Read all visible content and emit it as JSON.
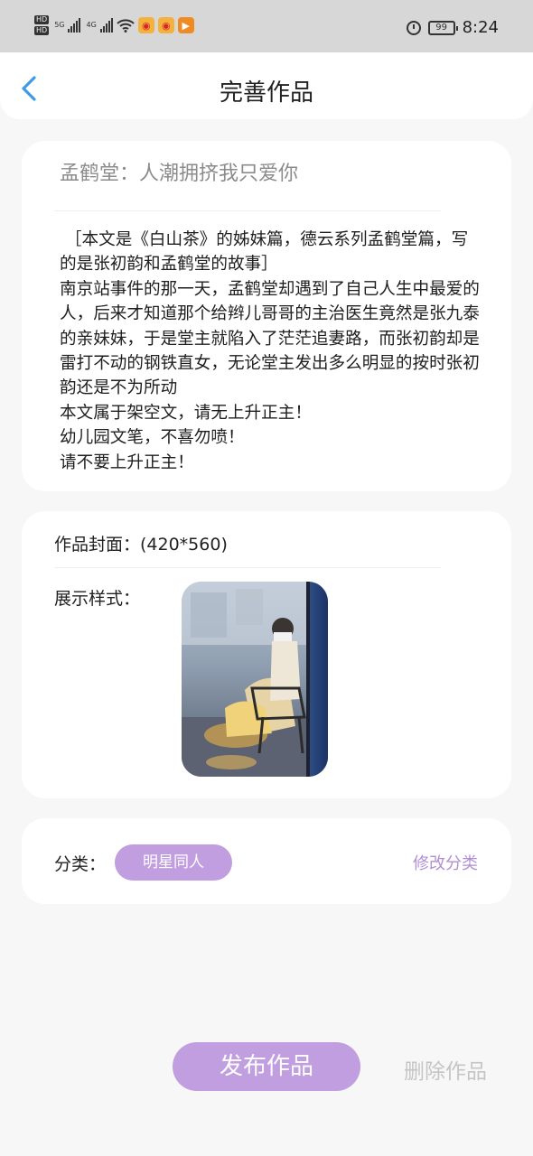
{
  "status_bar": {
    "sim1": "HD",
    "sim2": "HD",
    "net1": "5G",
    "net2": "4G",
    "battery": "99",
    "time": "8:24",
    "icons": [
      "signal-icon",
      "wifi-icon",
      "weibo-icon",
      "weibo-icon",
      "video-icon",
      "alarm-icon",
      "battery-icon"
    ]
  },
  "header": {
    "title": "完善作品",
    "back_icon": "chevron-left-icon"
  },
  "work": {
    "title": "孟鹤堂：人潮拥挤我只爱你",
    "summary": " ［本文是《白山茶》的姊妹篇，德云系列孟鹤堂篇，写的是张初韵和孟鹤堂的故事］\n南京站事件的那一天，孟鹤堂却遇到了自己人生中最爱的人，后来才知道那个给辫儿哥哥的主治医生竟然是张九泰的亲妹妹，于是堂主就陷入了茫茫追妻路，而张初韵却是雷打不动的钢铁直女，无论堂主发出多么明显的按时张初韵还是不为所动\n本文属于架空文，请无上升正主！\n幼儿园文笔，不喜勿喷！\n请不要上升正主！"
  },
  "cover": {
    "label": "作品封面：(420*560)",
    "display_label": "展示样式："
  },
  "category": {
    "label": "分类：",
    "value": "明星同人",
    "edit_label": "修改分类"
  },
  "actions": {
    "publish_label": "发布作品",
    "delete_label": "删除作品"
  },
  "colors": {
    "accent": "#c19edf",
    "accent_text": "#b18ed3",
    "back_icon": "#3d9be9",
    "background": "#f7f7f7"
  }
}
